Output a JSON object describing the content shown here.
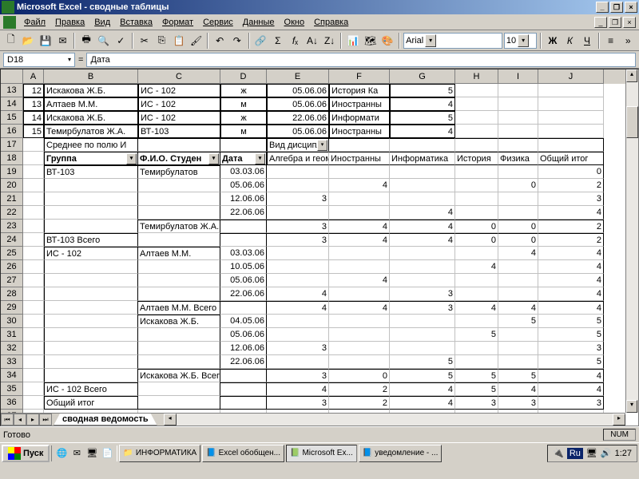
{
  "app": {
    "title": "Microsoft Excel - сводные таблицы"
  },
  "menu": {
    "file": "Файл",
    "edit": "Правка",
    "view": "Вид",
    "insert": "Вставка",
    "format": "Формат",
    "tools": "Сервис",
    "data": "Данные",
    "window": "Окно",
    "help": "Справка"
  },
  "toolbar": {
    "font": "Arial",
    "size": "10"
  },
  "formula": {
    "name": "D18",
    "label": "=",
    "value": "Дата"
  },
  "columns": [
    "A",
    "B",
    "C",
    "D",
    "E",
    "F",
    "G",
    "H",
    "I",
    "J"
  ],
  "rowNums": [
    13,
    14,
    15,
    16,
    17,
    18,
    19,
    20,
    21,
    22,
    23,
    24,
    25,
    26,
    27,
    28,
    29,
    30,
    31,
    32,
    33,
    34,
    35,
    36,
    37
  ],
  "topRows": [
    {
      "a": "12",
      "b": "Искакова Ж.Б.",
      "c": "ИС - 102",
      "d": "ж",
      "e": "05.06.06",
      "f": "История Ка",
      "g": "5"
    },
    {
      "a": "13",
      "b": "Алтаев М.М.",
      "c": "ИС - 102",
      "d": "м",
      "e": "05.06.06",
      "f": "Иностранны",
      "g": "4"
    },
    {
      "a": "14",
      "b": "Искакова Ж.Б.",
      "c": "ИС - 102",
      "d": "ж",
      "e": "22.06.06",
      "f": "Информати",
      "g": "5"
    },
    {
      "a": "15",
      "b": "Темирбулатов Ж.А.",
      "c": "ВТ-103",
      "d": "м",
      "e": "05.06.06",
      "f": "Иностранны",
      "g": "4"
    }
  ],
  "pivot": {
    "srednee": "Среднее по полю И",
    "vid": "Вид дисципл",
    "hdr": {
      "gruppa": "Группа",
      "fio": "Ф.И.О. Студен",
      "data": "Дата",
      "e": "Алгебра и геом",
      "f": "Иностранны",
      "g": "Информатика",
      "h": "История",
      "i": "Физика",
      "j": "Общий итог"
    },
    "rows": [
      {
        "b": "ВТ-103",
        "c": "Темирбулатов",
        "d": "03.03.06",
        "g": "",
        "j": "0"
      },
      {
        "d": "05.06.06",
        "f": "4",
        "i": "0",
        "j": "2"
      },
      {
        "d": "12.06.06",
        "e": "3",
        "j": "3"
      },
      {
        "d": "22.06.06",
        "g": "4",
        "j": "4"
      },
      {
        "c": "Темирбулатов Ж.А. Всего",
        "e": "3",
        "f": "4",
        "g": "4",
        "h": "0",
        "i": "0",
        "j": "2"
      },
      {
        "b": "ВТ-103 Всего",
        "e": "3",
        "f": "4",
        "g": "4",
        "h": "0",
        "i": "0",
        "j": "2"
      },
      {
        "b": "ИС - 102",
        "c": "Алтаев М.М.",
        "d": "03.03.06",
        "i": "4",
        "j": "4"
      },
      {
        "d": "10.05.06",
        "h": "4",
        "j": "4"
      },
      {
        "d": "05.06.06",
        "f": "4",
        "j": "4"
      },
      {
        "d": "22.06.06",
        "e": "4",
        "g": "3",
        "j": "4"
      },
      {
        "c": "Алтаев М.М. Всего",
        "e": "4",
        "f": "4",
        "g": "3",
        "h": "4",
        "i": "4",
        "j": "4"
      },
      {
        "c": "Искакова Ж.Б.",
        "d": "04.05.06",
        "i": "5",
        "j": "5"
      },
      {
        "d": "05.06.06",
        "h": "5",
        "j": "5"
      },
      {
        "d": "12.06.06",
        "e": "3",
        "j": "3"
      },
      {
        "d": "22.06.06",
        "g": "5",
        "j": "5"
      },
      {
        "c": "Искакова Ж.Б. Всего",
        "e": "3",
        "f": "0",
        "g": "5",
        "h": "5",
        "i": "5",
        "j": "4"
      },
      {
        "b": "ИС - 102 Всего",
        "e": "4",
        "f": "2",
        "g": "4",
        "h": "5",
        "i": "4",
        "j": "4"
      },
      {
        "b": "Общий итог",
        "e": "3",
        "f": "2",
        "g": "4",
        "h": "3",
        "i": "3",
        "j": "3"
      }
    ]
  },
  "sheet": "сводная ведомость",
  "status": {
    "ready": "Готово",
    "num": "NUM"
  },
  "taskbar": {
    "start": "Пуск",
    "tasks": [
      "ИНФОРМАТИКА",
      "Excel обобщен...",
      "Microsoft Ex...",
      "уведомление - ..."
    ],
    "lang": "Ru",
    "clock": "1:27"
  }
}
